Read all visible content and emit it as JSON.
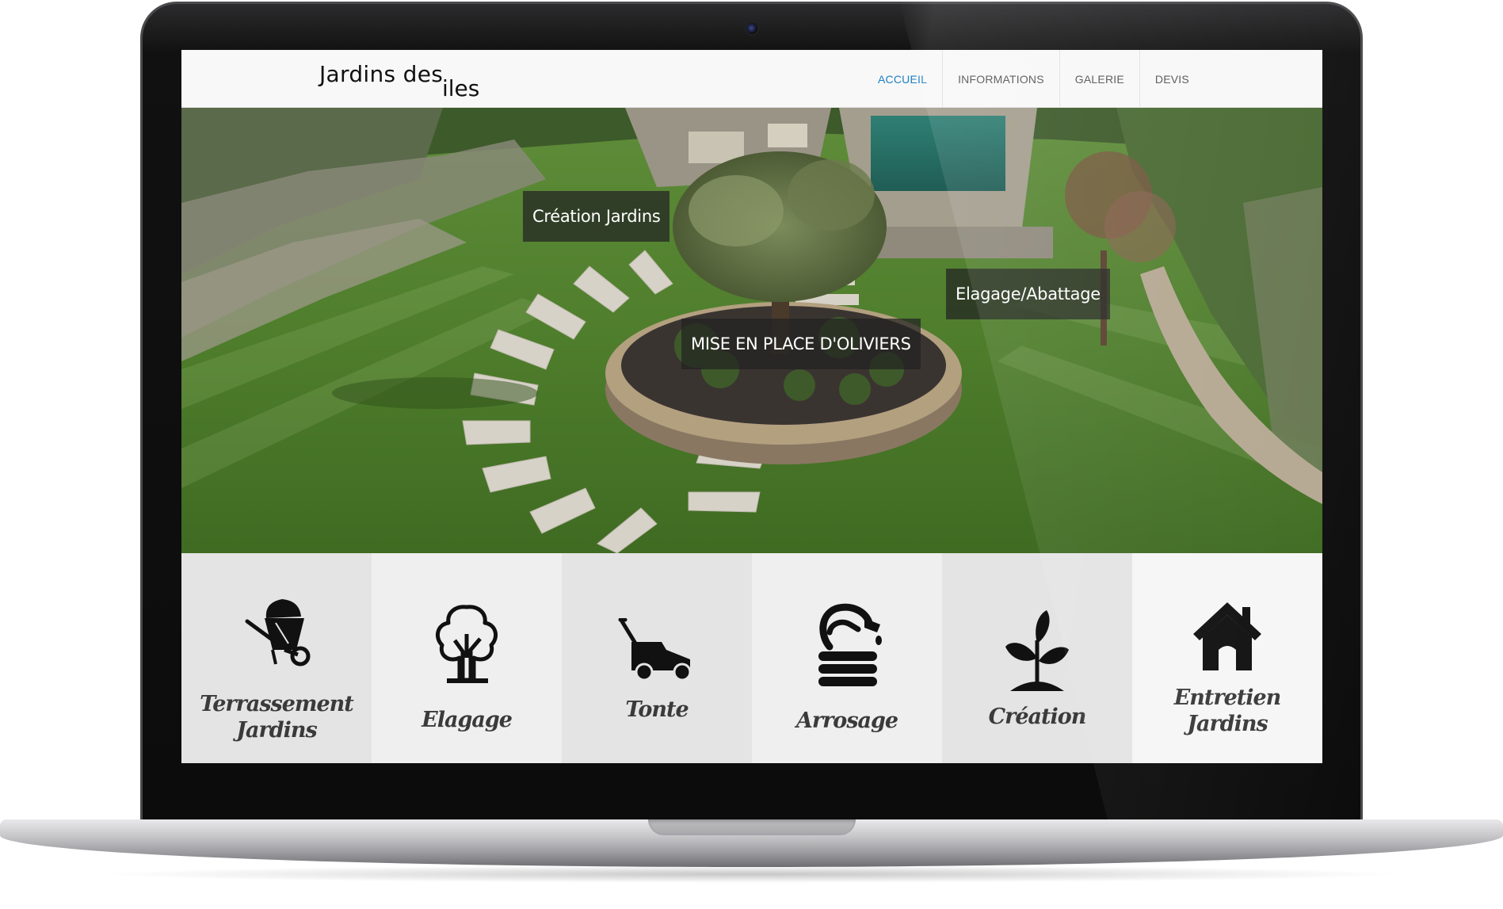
{
  "site": {
    "logo_line1": "Jardins des",
    "logo_line2": "iles"
  },
  "nav": {
    "items": [
      {
        "label": "ACCUEIL",
        "active": true
      },
      {
        "label": "INFORMATIONS",
        "active": false
      },
      {
        "label": "GALERIE",
        "active": false
      },
      {
        "label": "DEVIS",
        "active": false
      }
    ],
    "active_color": "#1c7fc2"
  },
  "hero": {
    "labels": [
      {
        "text": "Création Jardins"
      },
      {
        "text": "Elagage/Abattage"
      },
      {
        "text": "MISE EN PLACE D'OLIVIERS"
      }
    ]
  },
  "services": [
    {
      "label": "Terrassement Jardins",
      "icon": "wheelbarrow-icon"
    },
    {
      "label": "Elagage",
      "icon": "tree-icon"
    },
    {
      "label": "Tonte",
      "icon": "lawn-mower-icon"
    },
    {
      "label": "Arrosage",
      "icon": "garden-hose-icon"
    },
    {
      "label": "Création",
      "icon": "sprout-icon"
    },
    {
      "label": "Entretien Jardins",
      "icon": "house-icon"
    }
  ],
  "colors": {
    "service_bg_1": "#e4e4e4",
    "service_bg_2": "#efefef",
    "service_bg_6": "#f6f6f6"
  }
}
